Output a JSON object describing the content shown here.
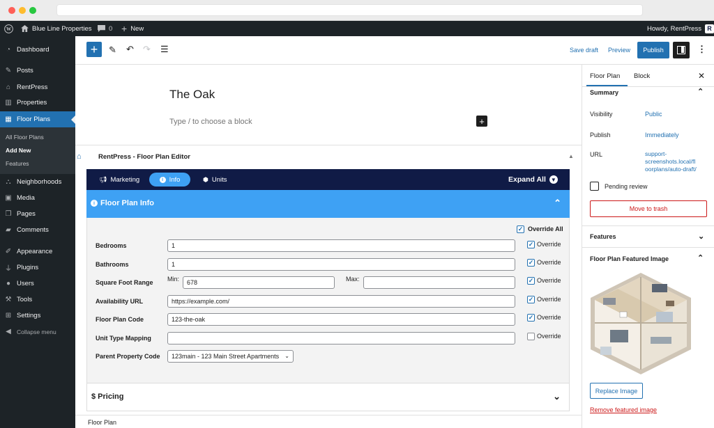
{
  "adminbar": {
    "site_name": "Blue Line Properties",
    "comments_count": "0",
    "new_label": "New",
    "howdy": "Howdy, RentPress"
  },
  "sidebar": {
    "items": [
      {
        "label": "Dashboard",
        "icon": "dashboard-icon"
      },
      {
        "label": "Posts",
        "icon": "pin-icon"
      },
      {
        "label": "RentPress",
        "icon": "rentpress-icon"
      },
      {
        "label": "Properties",
        "icon": "building-icon"
      },
      {
        "label": "Floor Plans",
        "icon": "grid-icon"
      },
      {
        "label": "Neighborhoods",
        "icon": "neighborhood-icon"
      },
      {
        "label": "Media",
        "icon": "media-icon"
      },
      {
        "label": "Pages",
        "icon": "pages-icon"
      },
      {
        "label": "Comments",
        "icon": "comment-icon"
      },
      {
        "label": "Appearance",
        "icon": "brush-icon"
      },
      {
        "label": "Plugins",
        "icon": "plugin-icon"
      },
      {
        "label": "Users",
        "icon": "user-icon"
      },
      {
        "label": "Tools",
        "icon": "wrench-icon"
      },
      {
        "label": "Settings",
        "icon": "settings-icon"
      }
    ],
    "submenu": [
      "All Floor Plans",
      "Add New",
      "Features"
    ],
    "collapse": "Collapse menu"
  },
  "toolbar": {
    "save_draft": "Save draft",
    "preview": "Preview",
    "publish": "Publish"
  },
  "editor": {
    "title": "The Oak",
    "placeholder": "Type / to choose a block"
  },
  "rentpress": {
    "header": "RentPress - Floor Plan Editor",
    "tabs": [
      "Marketing",
      "Info",
      "Units"
    ],
    "expand_all": "Expand All",
    "section_title": "Floor Plan Info",
    "override_all": "Override All",
    "override_label": "Override",
    "min_label": "Min:",
    "max_label": "Max:",
    "fields": [
      {
        "label": "Bedrooms",
        "value": "1",
        "override": true
      },
      {
        "label": "Bathrooms",
        "value": "1",
        "override": true
      },
      {
        "label": "Square Foot Range",
        "min": "678",
        "max": "",
        "override": true
      },
      {
        "label": "Availability URL",
        "value": "https://example.com/",
        "override": true
      },
      {
        "label": "Floor Plan Code",
        "value": "123-the-oak",
        "override": true
      },
      {
        "label": "Unit Type Mapping",
        "value": "",
        "override": false
      },
      {
        "label": "Parent Property Code",
        "value": "123main - 123 Main Street Apartments"
      }
    ],
    "pricing": "$ Pricing"
  },
  "footer_label": "Floor Plan",
  "panel": {
    "tabs": [
      "Floor Plan",
      "Block"
    ],
    "summary": "Summary",
    "visibility_label": "Visibility",
    "visibility_value": "Public",
    "publish_label": "Publish",
    "publish_value": "Immediately",
    "url_label": "URL",
    "url_lines": [
      "support-",
      "screenshots.local/fl",
      "oorplans/auto-draft/"
    ],
    "pending_review": "Pending review",
    "move_to_trash": "Move to trash",
    "features": "Features",
    "featured_image": "Floor Plan Featured Image",
    "replace_image": "Replace Image",
    "remove_image": "Remove featured image"
  }
}
